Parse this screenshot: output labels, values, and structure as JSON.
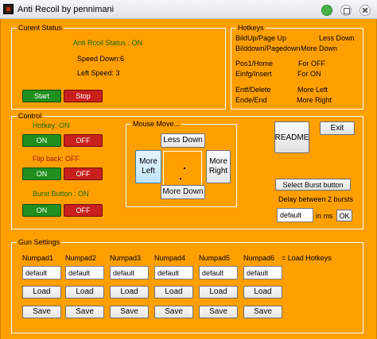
{
  "window": {
    "title": "Anti Recoil by pennimani"
  },
  "status": {
    "group_label": "Curent Status",
    "anti_recoil": "Anti Rcoil Status : ON",
    "speed_down": "Speed Down:6",
    "left_speed": "Left Speed: 3",
    "start_label": "Start",
    "stop_label": "Stop"
  },
  "hotkeys": {
    "group_label": "Hotkeys",
    "rows": [
      {
        "key": "BildUp/Page Up",
        "action": "Less Down"
      },
      {
        "key": "Bilddown/Pagedown",
        "action": "More Down"
      },
      {
        "key": "Pos1/Home",
        "action": "For OFF"
      },
      {
        "key": "Einfg/Insert",
        "action": "For ON"
      },
      {
        "key": "Entf/Delete",
        "action": "More Left"
      },
      {
        "key": "Ende/End",
        "action": "More Right"
      }
    ]
  },
  "control": {
    "group_label": "Control",
    "hotkey_status": "Hotkey: ON",
    "flip_back_status": "Flip back: OFF",
    "burst_status": "Burst Button : ON",
    "on_label": "ON",
    "off_label": "OFF"
  },
  "mouse_move": {
    "group_label": "Mouse Move...",
    "less_down": "Less Down",
    "more_down": "More Down",
    "more_left": "More\nLeft",
    "more_right": "More\nRight"
  },
  "side": {
    "readme": "README",
    "exit": "Exit",
    "select_burst": "Select Burst button",
    "delay_label": "Delay between 2 bursts",
    "delay_value": "default",
    "delay_unit": "in ms",
    "ok": "OK"
  },
  "gun": {
    "group_label": "Gun Settings",
    "numpads": [
      "Numpad1",
      "Numpad2",
      "Numpad3",
      "Numpad4",
      "Numpad5",
      "Numpad6"
    ],
    "load_hint": "= Load Hotkeys",
    "default_value": "default",
    "load_label": "Load",
    "save_label": "Save"
  },
  "colors": {
    "background": "#ff9f00",
    "on": "#1f8f1f",
    "off": "#c8201c"
  }
}
